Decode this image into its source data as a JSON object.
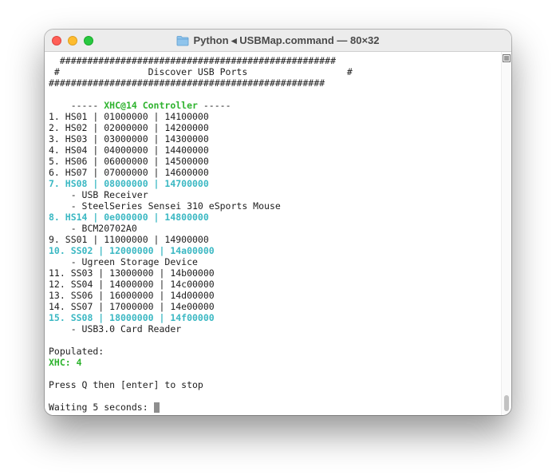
{
  "window": {
    "title_app": "Python",
    "title_separator": " ◂ ",
    "title_file": "USBMap.command",
    "title_dims": " — 80×32"
  },
  "terminal": {
    "banner_top": "  ##################################################",
    "banner_mid": " #                Discover USB Ports                  #",
    "banner_bottom": "##################################################",
    "controller_prefix": "    ----- ",
    "controller_name": "XHC@14 Controller",
    "controller_suffix": " -----",
    "ports": [
      "1. HS01 | 01000000 | 14100000",
      "2. HS02 | 02000000 | 14200000",
      "3. HS03 | 03000000 | 14300000",
      "4. HS04 | 04000000 | 14400000",
      "5. HS06 | 06000000 | 14500000",
      "6. HS07 | 07000000 | 14600000",
      "7. HS08 | 08000000 | 14700000",
      "    - USB Receiver",
      "    - SteelSeries Sensei 310 eSports Mouse",
      "8. HS14 | 0e000000 | 14800000",
      "    - BCM20702A0",
      "9. SS01 | 11000000 | 14900000",
      "10. SS02 | 12000000 | 14a00000",
      "    - Ugreen Storage Device",
      "11. SS03 | 13000000 | 14b00000",
      "12. SS04 | 14000000 | 14c00000",
      "13. SS06 | 16000000 | 14d00000",
      "14. SS07 | 17000000 | 14e00000",
      "15. SS08 | 18000000 | 14f00000",
      "    - USB3.0 Card Reader"
    ],
    "populated_label": "Populated:",
    "populated_value": "XHC: 4",
    "stop_prompt": "Press Q then [enter] to stop",
    "waiting": "Waiting 5 seconds: ",
    "highlight_colors": {
      "controller": "#2fb32f",
      "populated_port": "#3bb8c3"
    }
  },
  "icons": {
    "folder": "folder-icon",
    "menu": "menu-lines-icon"
  }
}
